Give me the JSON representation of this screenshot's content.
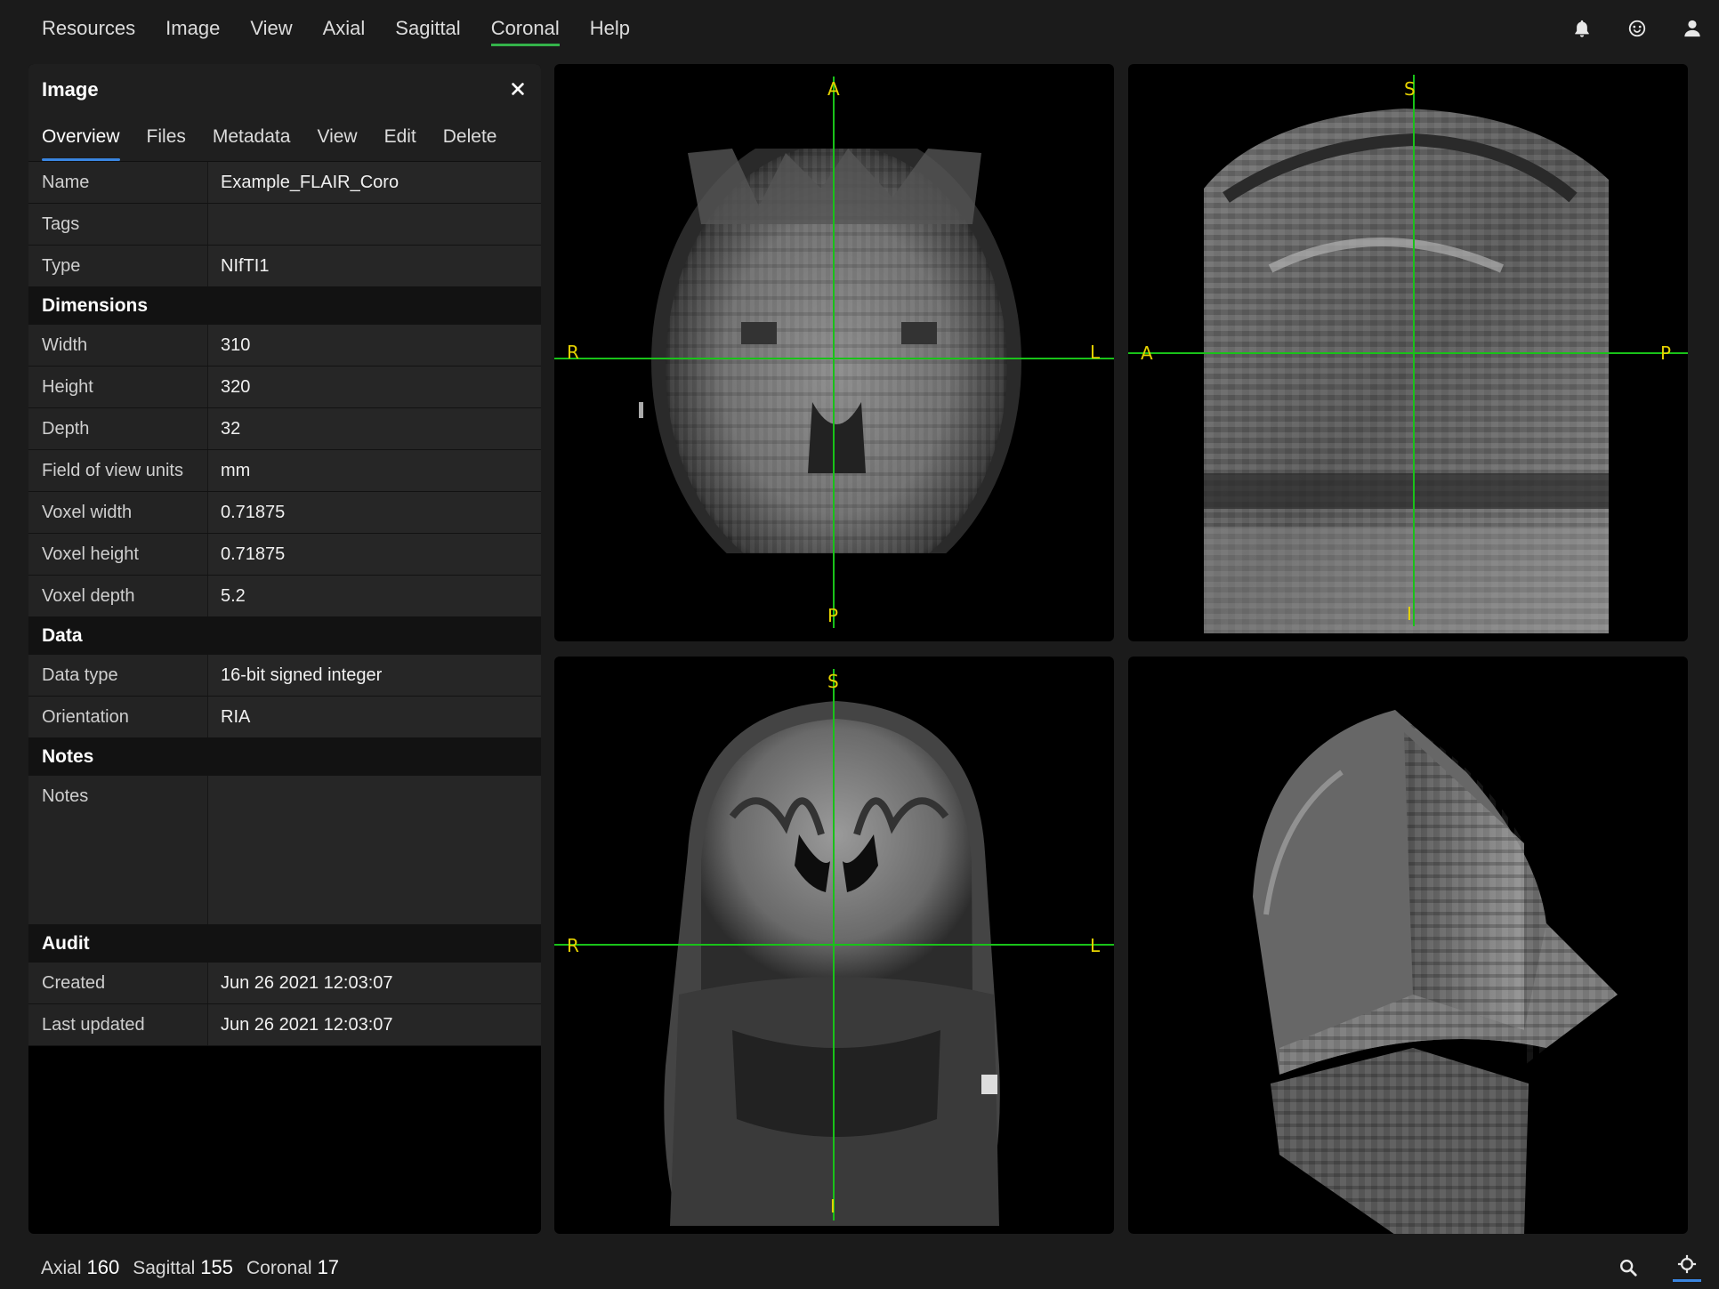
{
  "menu": {
    "items": [
      "Resources",
      "Image",
      "View",
      "Axial",
      "Sagittal",
      "Coronal",
      "Help"
    ],
    "active": "Coronal",
    "icons": [
      "bell-icon",
      "smiley-icon",
      "user-icon"
    ]
  },
  "panel": {
    "title": "Image",
    "tabs": [
      "Overview",
      "Files",
      "Metadata",
      "View",
      "Edit",
      "Delete"
    ],
    "active_tab": "Overview",
    "rows": {
      "name": {
        "label": "Name",
        "value": "Example_FLAIR_Coro"
      },
      "tags": {
        "label": "Tags",
        "value": ""
      },
      "type": {
        "label": "Type",
        "value": "NIfTI1"
      }
    },
    "dimensions": {
      "heading": "Dimensions",
      "width": {
        "label": "Width",
        "value": "310"
      },
      "height": {
        "label": "Height",
        "value": "320"
      },
      "depth": {
        "label": "Depth",
        "value": "32"
      },
      "fov_units": {
        "label": "Field of view units",
        "value": "mm"
      },
      "voxel_width": {
        "label": "Voxel width",
        "value": "0.71875"
      },
      "voxel_height": {
        "label": "Voxel height",
        "value": "0.71875"
      },
      "voxel_depth": {
        "label": "Voxel depth",
        "value": "5.2"
      }
    },
    "data": {
      "heading": "Data",
      "data_type": {
        "label": "Data type",
        "value": "16-bit signed integer"
      },
      "orientation": {
        "label": "Orientation",
        "value": "RIA"
      }
    },
    "notes": {
      "heading": "Notes",
      "label": "Notes",
      "value": ""
    },
    "audit": {
      "heading": "Audit",
      "created": {
        "label": "Created",
        "value": "Jun 26 2021 12:03:07"
      },
      "updated": {
        "label": "Last updated",
        "value": "Jun 26 2021 12:03:07"
      }
    }
  },
  "viewports": {
    "axial": {
      "top": "A",
      "bottom": "P",
      "left": "R",
      "right": "L"
    },
    "sagittal": {
      "top": "S",
      "bottom": "I",
      "left": "A",
      "right": "P"
    },
    "coronal": {
      "top": "S",
      "bottom": "I",
      "left": "R",
      "right": "L"
    }
  },
  "status": {
    "axial_label": "Axial",
    "axial_value": "160",
    "sagittal_label": "Sagittal",
    "sagittal_value": "155",
    "coronal_label": "Coronal",
    "coronal_value": "17",
    "icons": [
      "search-icon",
      "crosshair-icon"
    ]
  },
  "colors": {
    "accent_tab": "#3a85e0",
    "menu_active": "#34b34a",
    "crosshair": "#19c219",
    "orientation_label": "#e6d200"
  }
}
